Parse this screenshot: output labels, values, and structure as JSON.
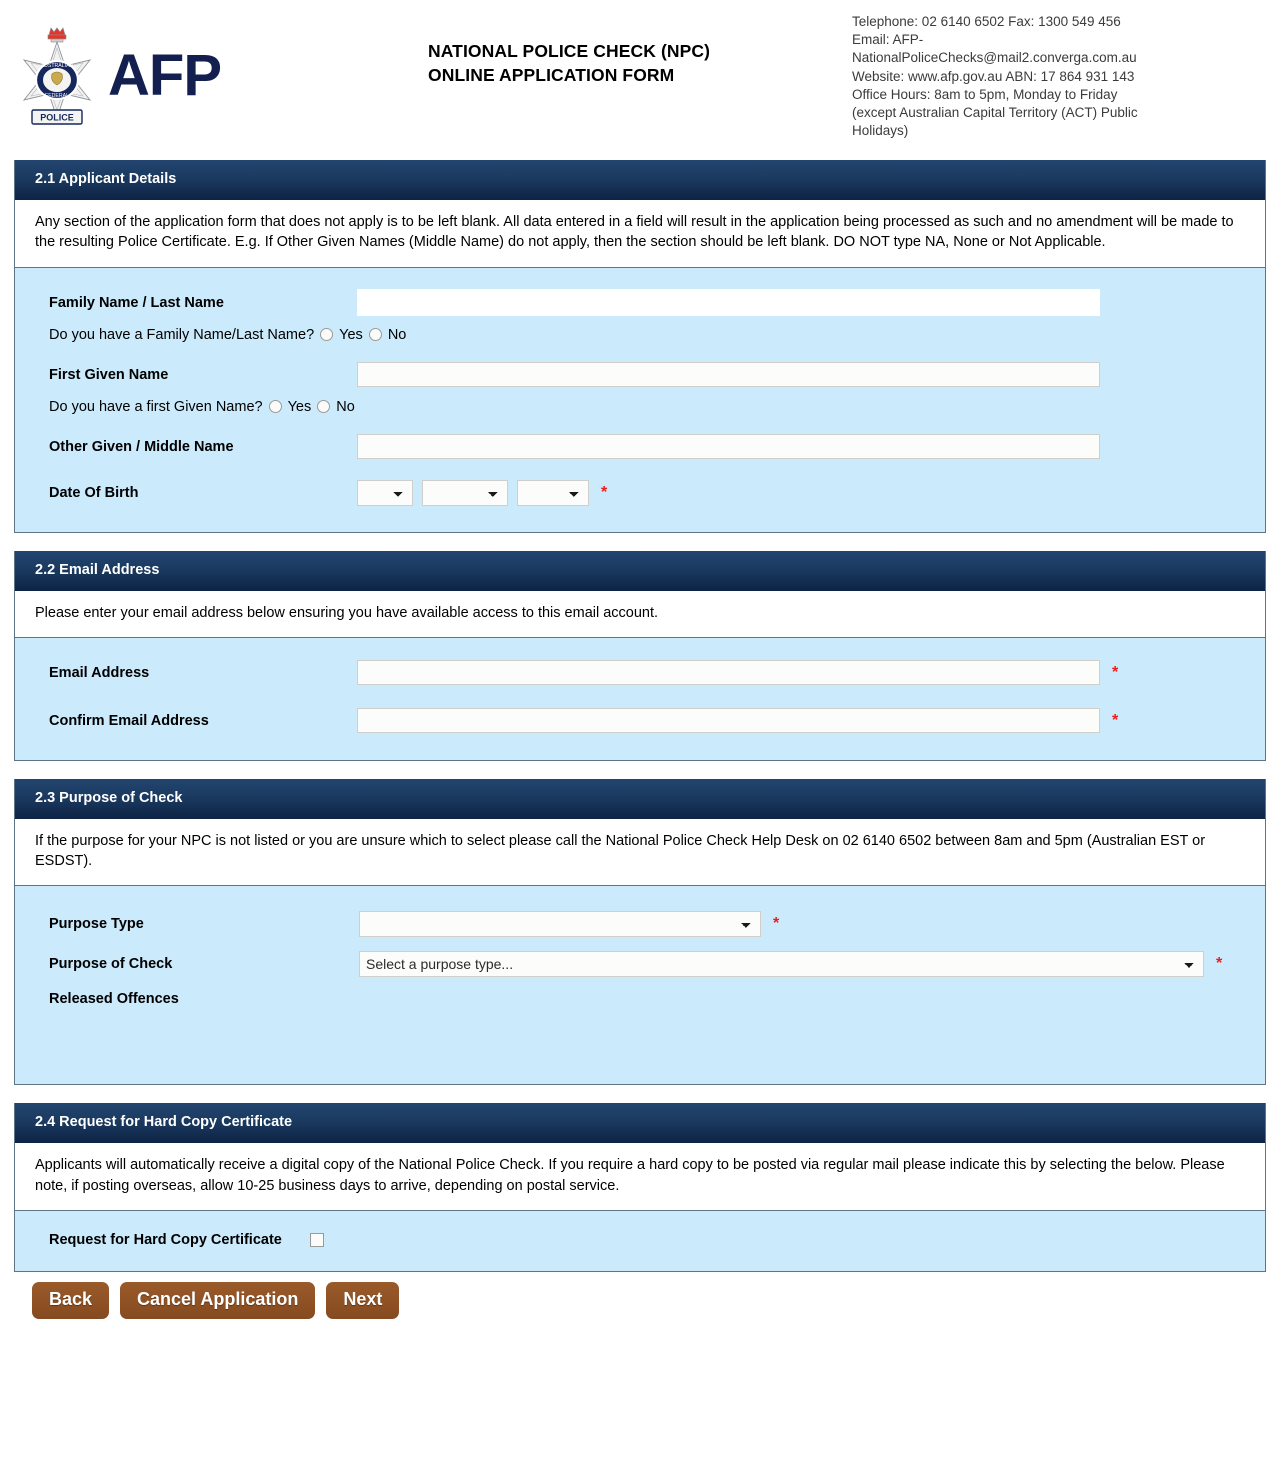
{
  "header": {
    "logo_text": "AFP",
    "logo_icon": "afp-crest-icon",
    "form_title_line1": "NATIONAL POLICE CHECK (NPC)",
    "form_title_line2": "ONLINE APPLICATION FORM",
    "contact": {
      "line1": "Telephone: 02 6140 6502  Fax: 1300 549 456",
      "line2": "Email: AFP-",
      "line3": "NationalPoliceChecks@mail2.converga.com.au",
      "line4": "Website: www.afp.gov.au    ABN: 17 864 931 143",
      "line5": "Office Hours: 8am to 5pm, Monday to Friday",
      "line6": "(except Australian Capital Territory (ACT) Public",
      "line7": "Holidays)"
    }
  },
  "colors": {
    "section_header_bg": "#12355f",
    "section_body_bg": "#cbeafc",
    "required_asterisk": "#ef1c1c",
    "button_bg": "#8a4f23",
    "logo_navy": "#13204f"
  },
  "section_applicant": {
    "title": "2.1 Applicant Details",
    "note": "Any section of the application form that does not apply is to be left blank. All data entered in a field will result in the application being processed as such and no amendment will be made to the resulting Police Certificate. E.g. If Other Given Names (Middle Name) do not apply, then the section should be left blank. DO NOT type NA, None or Not Applicable.",
    "fields": {
      "family_name_label": "Family Name / Last Name",
      "family_name_value": "",
      "family_name_question": "Do you have a Family Name/Last Name?",
      "family_name_yes": "Yes",
      "family_name_no": "No",
      "first_given_name_label": "First Given Name",
      "first_given_name_value": "",
      "first_given_name_question": "Do you have a first Given Name?",
      "first_given_name_yes": "Yes",
      "first_given_name_no": "No",
      "other_given_name_label": "Other Given / Middle Name",
      "other_given_name_value": "",
      "dob_label": "Date Of Birth",
      "dob_day_value": "",
      "dob_month_value": "",
      "dob_year_value": "",
      "dob_required": "*"
    }
  },
  "section_email": {
    "title": "2.2 Email Address",
    "note": "Please enter your email address below ensuring you have available access to this email account.",
    "fields": {
      "email_label": "Email Address",
      "email_value": "",
      "email_required": "*",
      "confirm_email_label": "Confirm Email Address",
      "confirm_email_value": "",
      "confirm_email_required": "*"
    }
  },
  "section_purpose": {
    "title": "2.3 Purpose of Check",
    "note": "If the purpose for your NPC is not listed or you are unsure which to select please call the National Police Check Help Desk on 02 6140 6502 between 8am and 5pm (Australian EST or ESDST).",
    "fields": {
      "purpose_type_label": "Purpose Type",
      "purpose_type_value": "",
      "purpose_type_required": "*",
      "purpose_of_check_label": "Purpose of Check",
      "purpose_of_check_value": "Select a purpose type...",
      "purpose_of_check_required": "*",
      "released_offences_label": "Released Offences"
    }
  },
  "section_hardcopy": {
    "title": "2.4 Request for Hard Copy Certificate",
    "note": "Applicants will automatically receive a digital copy of the National Police Check. If you require a hard copy to be posted via regular mail please indicate this by selecting the below. Please note, if posting overseas, allow 10-25 business days to arrive, depending on postal service.",
    "fields": {
      "hardcopy_label": "Request for Hard Copy Certificate",
      "hardcopy_checked": false
    }
  },
  "buttons": {
    "back": "Back",
    "cancel": "Cancel Application",
    "next": "Next"
  }
}
